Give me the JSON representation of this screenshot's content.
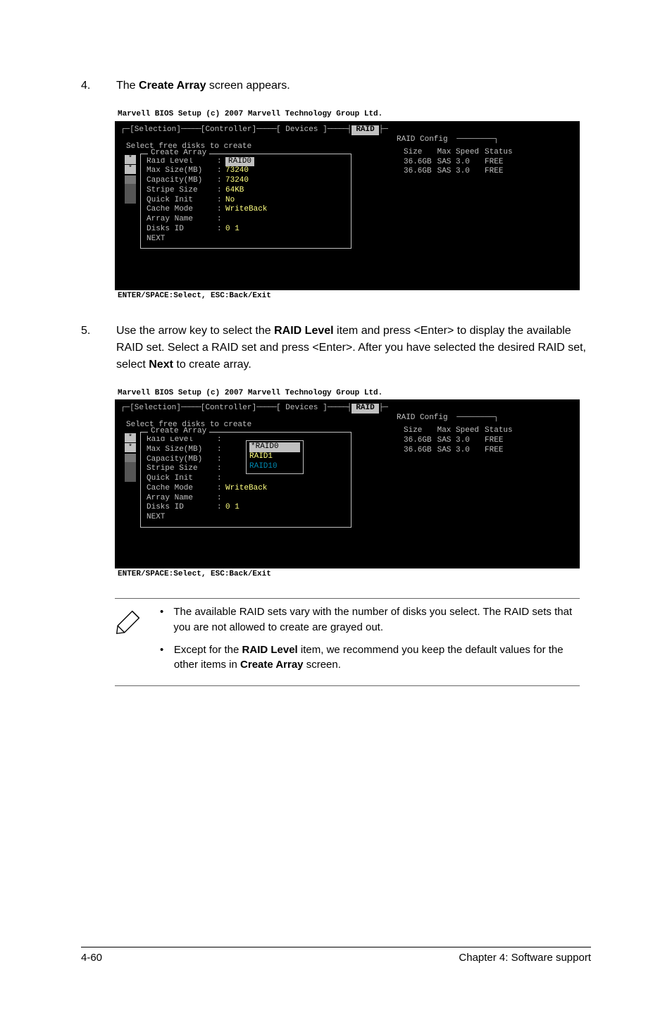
{
  "step4": {
    "num": "4.",
    "text_before": "The ",
    "bold": "Create Array",
    "text_after": " screen appears."
  },
  "step5": {
    "num": "5.",
    "segments": [
      "Use the arrow key to select the ",
      "RAID Level",
      " item and press <Enter> to display the available RAID set. Select a RAID set and press <Enter>. After you have selected the desired RAID set, select ",
      "Next",
      " to create array."
    ]
  },
  "bios": {
    "title": "Marvell BIOS Setup (c) 2007 Marvell Technology Group Ltd.",
    "top_labels": {
      "selection": "[Selection]",
      "controller": "[Controller]",
      "devices": "[ Devices ]",
      "raid": " RAID "
    },
    "raid_config": "RAID Config",
    "select_free": "Select free disks to create",
    "create_title": "Create Array",
    "rows1": [
      {
        "label": "Raid Level",
        "value": "RAID0",
        "hl": true
      },
      {
        "label": "Max Size(MB)",
        "value": "73240"
      },
      {
        "label": "Capacity(MB)",
        "value": "73240"
      },
      {
        "label": "Stripe Size",
        "value": "64KB"
      },
      {
        "label": "Quick Init",
        "value": "No"
      },
      {
        "label": "Cache Mode",
        "value": "WriteBack"
      },
      {
        "label": "Array Name",
        "value": ""
      },
      {
        "label": "Disks ID",
        "value": "0 1"
      },
      {
        "label": "NEXT",
        "value": ""
      }
    ],
    "rows2": [
      {
        "label": "Raid Level",
        "value": ""
      },
      {
        "label": "Max Size(MB)",
        "value": ""
      },
      {
        "label": "Capacity(MB)",
        "value": ""
      },
      {
        "label": "Stripe Size",
        "value": ""
      },
      {
        "label": "Quick Init",
        "value": ""
      },
      {
        "label": "Cache Mode",
        "value": "WriteBack"
      },
      {
        "label": "Array Name",
        "value": ""
      },
      {
        "label": "Disks ID",
        "value": "0 1"
      },
      {
        "label": "NEXT",
        "value": ""
      }
    ],
    "popup": [
      "*RAID0",
      "RAID1",
      "RAID10"
    ],
    "disk_headers": [
      "Size",
      "Max Speed",
      "Status"
    ],
    "disks": [
      {
        "size": "36.6GB",
        "speed": "SAS 3.0",
        "status": "FREE"
      },
      {
        "size": "36.6GB",
        "speed": "SAS 3.0",
        "status": "FREE"
      }
    ],
    "footer": "ENTER/SPACE:Select, ESC:Back/Exit"
  },
  "notes": {
    "b1": [
      "The available RAID sets vary with the number of disks you select. The RAID sets that you are not allowed to create are grayed out."
    ],
    "b2_segments": [
      "Except for the ",
      "RAID Level",
      " item, we recommend you keep the default values for the other items in ",
      "Create Array",
      " screen."
    ]
  },
  "footer": {
    "page": "4-60",
    "chapter": "Chapter 4: Software support"
  }
}
